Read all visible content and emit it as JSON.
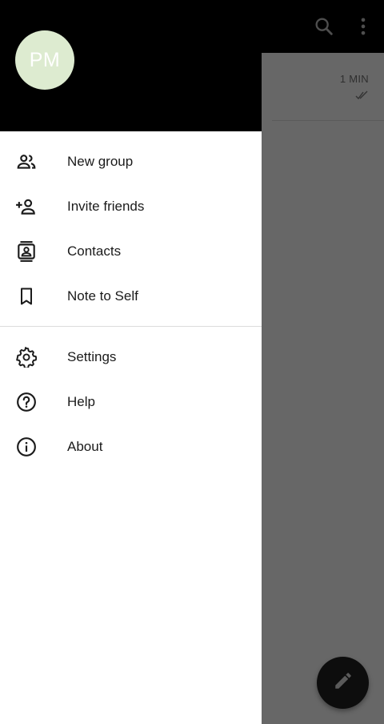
{
  "background": {
    "toolbar_icons": [
      "search-icon",
      "more-vert-icon"
    ],
    "conversation": {
      "time": "1 MIN",
      "status_icon": "double-check-icon"
    },
    "fab_icon": "pencil-icon"
  },
  "drawer": {
    "avatar_initials": "PM",
    "avatar_color": "#ddebd0",
    "primary_items": [
      {
        "label": "New group",
        "icon": "group-icon"
      },
      {
        "label": "Invite friends",
        "icon": "person-add-icon"
      },
      {
        "label": "Contacts",
        "icon": "contacts-icon"
      },
      {
        "label": "Note to Self",
        "icon": "bookmark-icon"
      }
    ],
    "secondary_items": [
      {
        "label": "Settings",
        "icon": "gear-icon"
      },
      {
        "label": "Help",
        "icon": "help-icon"
      },
      {
        "label": "About",
        "icon": "info-icon"
      }
    ]
  }
}
